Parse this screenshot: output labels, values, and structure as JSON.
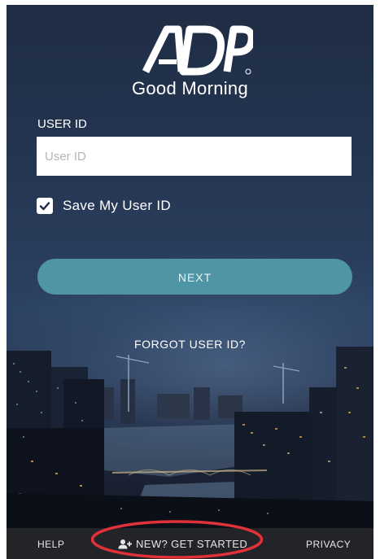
{
  "brand": {
    "logo_text": "ADP",
    "greeting": "Good Morning"
  },
  "login": {
    "userid_label": "USER ID",
    "userid_placeholder": "User ID",
    "userid_value": "",
    "save_label": "Save My User ID",
    "save_checked": true,
    "next_label": "NEXT",
    "forgot_label": "FORGOT USER ID?"
  },
  "footer": {
    "help_label": "HELP",
    "get_started_label": "NEW? GET STARTED",
    "privacy_label": "PRIVACY"
  },
  "icons": {
    "checkbox": "checkmark-icon",
    "get_started": "add-user-icon"
  },
  "colors": {
    "accent": "#4f95a6",
    "highlight": "#e0303a",
    "background": "#253652"
  }
}
